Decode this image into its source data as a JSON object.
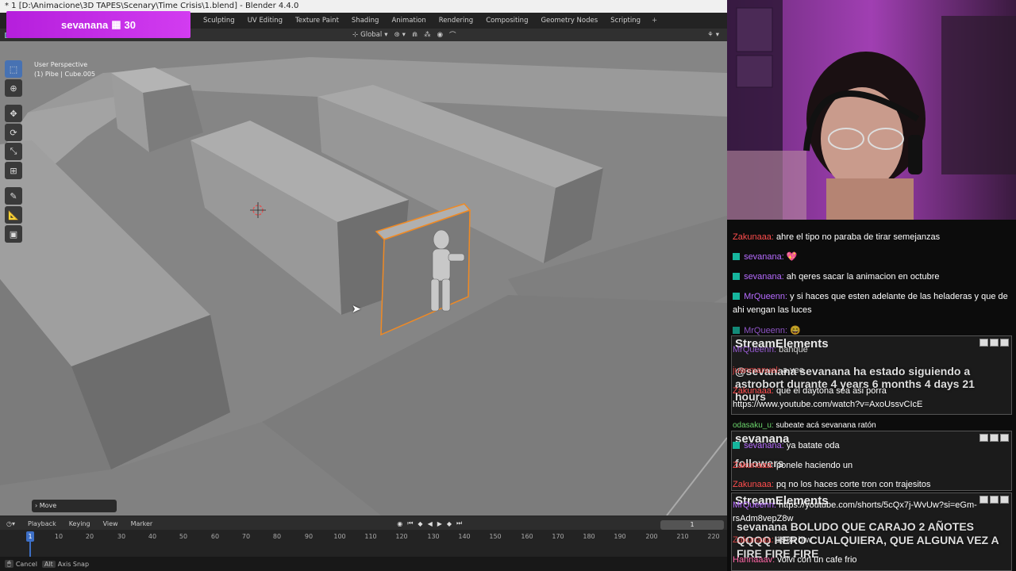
{
  "blender": {
    "title": "* 1 [D:\\Animacione\\3D TAPES\\Scenary\\Time Crisis\\1.blend] - Blender 4.4.0",
    "workspace_tabs": [
      "Sculpting",
      "UV Editing",
      "Texture Paint",
      "Shading",
      "Animation",
      "Rendering",
      "Compositing",
      "Geometry Nodes",
      "Scripting"
    ],
    "add_tab": "+",
    "header": {
      "transform_orientation": "Global"
    },
    "viewport": {
      "perspective": "User Perspective",
      "active_object": "(1) Pibe | Cube.005",
      "last_operator": "Move"
    },
    "timeline": {
      "menus": [
        "Playback",
        "Keying",
        "View",
        "Marker"
      ],
      "current_frame": "1",
      "frame_field": "1",
      "ticks": [
        "10",
        "20",
        "30",
        "40",
        "50",
        "60",
        "70",
        "80",
        "90",
        "100",
        "110",
        "120",
        "130",
        "140",
        "150",
        "160",
        "170",
        "180",
        "190",
        "200",
        "210",
        "220"
      ]
    },
    "status": {
      "cancel": "Cancel",
      "alt_key": "Alt",
      "axis_snap": "Axis Snap"
    }
  },
  "follower_badge": {
    "name": "sevanana",
    "icon": "calendar-icon",
    "count": "30"
  },
  "chat": {
    "messages": [
      {
        "user": "Zakunaaa:",
        "text": "ahre el tipo no paraba de tirar semejanzas",
        "color": "#ff4d4d"
      },
      {
        "user": "sevanana:",
        "text": "💖",
        "color": "#b66bff"
      },
      {
        "user": "sevanana:",
        "text": "ah qeres sacar la animacion en octubre",
        "color": "#b66bff"
      },
      {
        "user": "MrQueenn:",
        "text": "y si haces que esten adelante de las heladeras y que de ahi vengan las luces",
        "color": "#b66bff"
      },
      {
        "user": "MrQueenn:",
        "text": "😄",
        "color": "#b66bff"
      },
      {
        "user": "MrQueenn:",
        "text": "banque",
        "color": "#b66bff"
      },
      {
        "user": "juanmanuel:",
        "text": "a veo",
        "color": "#ff4d4d"
      },
      {
        "user": "Zakunaaa:",
        "text": "que el daytona sea asi porra https://www.youtube.com/watch?v=AxoUssvCIcE",
        "color": "#ff4d4d"
      },
      {
        "user": "odasaku_u:",
        "text": "subeate acá sevanana ratón",
        "color": "#6bd46b"
      },
      {
        "user": "sevanana:",
        "text": "ya batate oda",
        "color": "#b66bff"
      },
      {
        "user": "Zakunaaa:",
        "text": "ponele haciendo un",
        "color": "#ff4d4d"
      },
      {
        "user": "Zakunaaa:",
        "text": "pq no los haces corte tron con trajesitos",
        "color": "#ff4d4d"
      },
      {
        "user": "MrQueenn:",
        "text": "https://youtube.com/shorts/5cQx7j-WvUw?si=eGm-rsAdm8vepZ8w",
        "color": "#b66bff"
      },
      {
        "user": "Zakunaaa:",
        "text": "1985 btw",
        "color": "#ff4d4d"
      },
      {
        "user": "Hannaaav:",
        "text": "volvi con un cafe frio",
        "color": "#ff66a6"
      }
    ],
    "alerts": [
      {
        "title": "StreamElements",
        "text": "@sevanana sevanana ha estado siguiendo a astrobort durante 4 years 6 months 4 days 21 hours"
      },
      {
        "title": "sevanana",
        "text": "followers"
      },
      {
        "title": "StreamElements",
        "text": "sevanana BOLUDO QUE CARAJO 2 AÑOTES QQQQ HERO CUALQUIERA, QUE ALGUNA VEZ A FIRE FIRE FIRE"
      }
    ]
  }
}
